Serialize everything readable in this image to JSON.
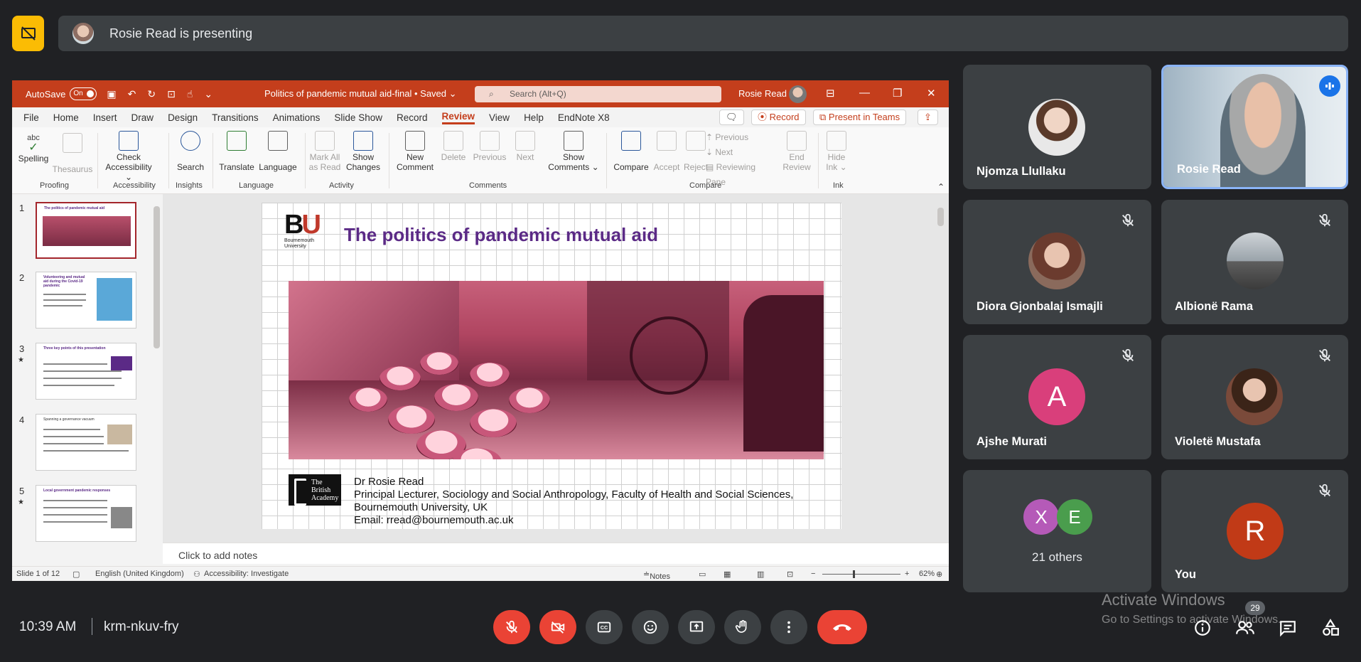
{
  "meet": {
    "presenting_text": "Rosie Read is presenting",
    "time": "10:39 AM",
    "meeting_code": "krm-nkuv-fry",
    "people_count": "29",
    "participants": [
      {
        "name": "Njomza Llullaku"
      },
      {
        "name": "Rosie Read"
      },
      {
        "name": "Diora Gjonbalaj Ismajli"
      },
      {
        "name": "Albionë Rama"
      },
      {
        "name": "Ajshe Murati",
        "initial": "A"
      },
      {
        "name": "Violetë Mustafa"
      },
      {
        "label": "21 others",
        "initials": [
          "X",
          "E"
        ]
      },
      {
        "name": "You",
        "initial": "R"
      }
    ],
    "colors": {
      "ajshe": "#d93f7b",
      "x": "#b55ab8",
      "e": "#4a9d4d",
      "you": "#c13a17",
      "end_call": "#ea4335"
    }
  },
  "ppt": {
    "autosave_label": "AutoSave",
    "autosave_state": "On",
    "doc_title": "Politics of pandemic mutual aid-final • Saved ⌄",
    "search_placeholder": "Search (Alt+Q)",
    "user_name": "Rosie Read",
    "menu": [
      "File",
      "Home",
      "Insert",
      "Draw",
      "Design",
      "Transitions",
      "Animations",
      "Slide Show",
      "Record",
      "Review",
      "View",
      "Help",
      "EndNote X8"
    ],
    "record_btn": "Record",
    "present_btn": "Present in Teams",
    "ribbon": {
      "spelling": "Spelling",
      "thesaurus": "Thesaurus",
      "check_accessibility": "Check Accessibility ⌄",
      "search": "Search",
      "translate": "Translate",
      "language": "Language",
      "mark_all_as_read": "Mark All as Read",
      "show_changes": "Show Changes",
      "new_comment": "New Comment",
      "delete": "Delete",
      "previous": "Previous",
      "next": "Next",
      "show_comments": "Show Comments ⌄",
      "compare": "Compare",
      "accept": "Accept",
      "reject": "Reject",
      "previous_change": "Previous",
      "next_change": "Next",
      "reviewing_pane": "Reviewing Pane",
      "end_review": "End Review",
      "hide_ink": "Hide Ink ⌄",
      "groups": [
        "Proofing",
        "Accessibility",
        "Insights",
        "Language",
        "Activity",
        "Comments",
        "Compare",
        "Ink"
      ]
    },
    "thumbs": [
      {
        "num": "1",
        "title": "The politics of pandemic mutual aid"
      },
      {
        "num": "2",
        "title": "Volunteering and mutual aid during the Covid-19 pandemic"
      },
      {
        "num": "3",
        "title": "Three key points of this presentation"
      },
      {
        "num": "4",
        "title": "Spanning a governance vacuum"
      },
      {
        "num": "5",
        "title": "Local government pandemic responses"
      }
    ],
    "slide": {
      "logo_letters_b": "B",
      "logo_letters_u": "U",
      "logo_sub": "Bournemouth University",
      "title": "The politics of pandemic mutual aid",
      "ba_logo": "The British Academy",
      "credit_name": "Dr Rosie Read",
      "credit_role": "Principal Lecturer, Sociology and Social Anthropology, Faculty of Health and Social Sciences,",
      "credit_org": "Bournemouth University, UK",
      "credit_email": "Email: rread@bournemouth.ac.uk"
    },
    "notes_placeholder": "Click to add notes",
    "status": {
      "slide": "Slide 1 of 12",
      "language": "English (United Kingdom)",
      "accessibility": "Accessibility: Investigate",
      "notes": "Notes",
      "zoom": "62%"
    }
  },
  "watermark": {
    "line1": "Activate Windows",
    "line2": "Go to Settings to activate Windows."
  }
}
